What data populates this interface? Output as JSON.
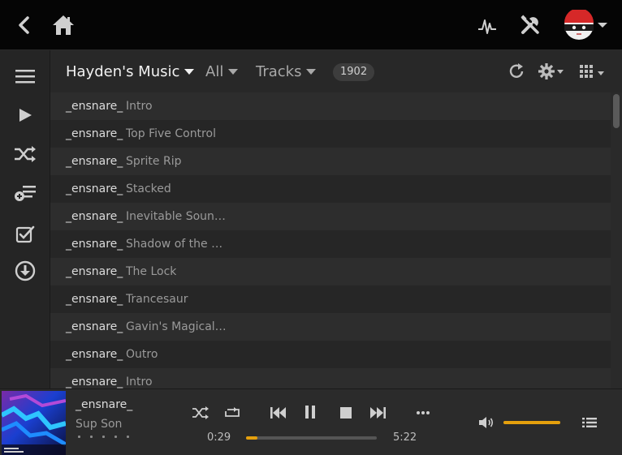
{
  "header": {
    "library_label": "Hayden's Music",
    "filter_label": "All",
    "type_label": "Tracks",
    "count": "1902"
  },
  "tracks": [
    {
      "artist": "_ensnare_",
      "title": "Intro"
    },
    {
      "artist": "_ensnare_",
      "title": "Top Five Control"
    },
    {
      "artist": "_ensnare_",
      "title": "Sprite Rip"
    },
    {
      "artist": "_ensnare_",
      "title": "Stacked"
    },
    {
      "artist": "_ensnare_",
      "title": "Inevitable Sound ..."
    },
    {
      "artist": "_ensnare_",
      "title": "Shadow of the Be..."
    },
    {
      "artist": "_ensnare_",
      "title": "The Lock"
    },
    {
      "artist": "_ensnare_",
      "title": "Trancesaur"
    },
    {
      "artist": "_ensnare_",
      "title": "Gavin's Magical R..."
    },
    {
      "artist": "_ensnare_",
      "title": "Outro"
    },
    {
      "artist": "_ensnare_",
      "title": "Intro"
    }
  ],
  "player": {
    "artist": "_ensnare_",
    "title": "Sup Son",
    "elapsed": "0:29",
    "duration": "5:22",
    "progress_fraction": 0.09,
    "volume_fraction": 1.0
  },
  "colors": {
    "accent": "#e5a00d",
    "topbar_bg": "#050505",
    "panel_bg": "#282828"
  },
  "icons": {
    "topbar": [
      "back-icon",
      "home-icon",
      "activity-icon",
      "settings-tools-icon",
      "user-avatar"
    ],
    "rail": [
      "menu-icon",
      "play-icon",
      "shuffle-icon",
      "playlist-add-icon",
      "select-check-icon",
      "download-icon"
    ],
    "player": [
      "shuffle-icon",
      "repeat-icon",
      "previous-icon",
      "pause-icon",
      "stop-icon",
      "next-icon",
      "more-icon",
      "volume-icon",
      "play-queue-icon"
    ]
  }
}
